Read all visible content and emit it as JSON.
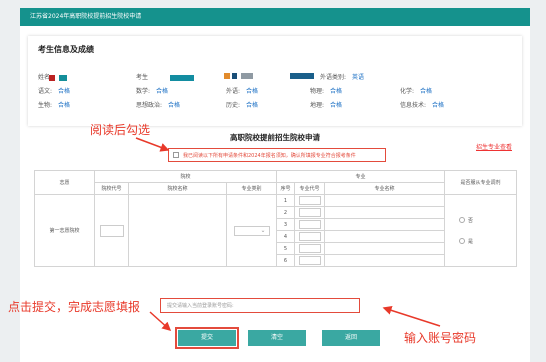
{
  "header": {
    "title": "江苏省2024年高职院校提前招生院校申请"
  },
  "info": {
    "title": "考生信息及成绩",
    "name_label": "姓名",
    "kaohao_label": "考生",
    "waiyu_label": "外语类别:",
    "waiyu_value": "英语",
    "rows": [
      [
        {
          "label": "语文:",
          "value": "合格"
        },
        {
          "label": "数学:",
          "value": "合格"
        },
        {
          "label": "外语:",
          "value": "合格"
        },
        {
          "label": "物理:",
          "value": "合格"
        },
        {
          "label": "化学:",
          "value": "合格"
        }
      ],
      [
        {
          "label": "生物:",
          "value": "合格"
        },
        {
          "label": "思想政治:",
          "value": "合格"
        },
        {
          "label": "历史:",
          "value": "合格"
        },
        {
          "label": "地理:",
          "value": "合格"
        },
        {
          "label": "信息技术:",
          "value": "合格"
        }
      ]
    ]
  },
  "form": {
    "title": "高职院校提前招生院校申请",
    "plan_link": "招生专业查看",
    "notice": "我已阅读以下所有申请条件和2024年报名须知，确认所填报专业符合报考条件",
    "col_order": "志愿",
    "col_school": "院校",
    "col_major": "专业",
    "col_obey": "是否服从专业调剂",
    "sub_school_code": "院校代号",
    "sub_school_name": "院校名称",
    "sub_category": "专业类别",
    "sub_seq": "序号",
    "sub_major_code": "专业代号",
    "sub_major_name": "专业名称",
    "row_label": "第一志愿院校",
    "seq": [
      "1",
      "2",
      "3",
      "4",
      "5",
      "6"
    ],
    "obey_no": "否",
    "obey_yes": "是"
  },
  "account": {
    "prompt": "提交请输入当前登录账号密码:"
  },
  "buttons": {
    "submit": "提交",
    "clear": "清空",
    "back": "返回"
  },
  "annotations": {
    "read_check": "阅读后勾选",
    "submit_hint": "点击提交，完成志愿填报",
    "account_hint": "输入账号密码"
  },
  "colors": {
    "header": "#15928d",
    "button": "#3aa8a2",
    "annotation": "#e8392a",
    "link": "#1a6fc4"
  }
}
